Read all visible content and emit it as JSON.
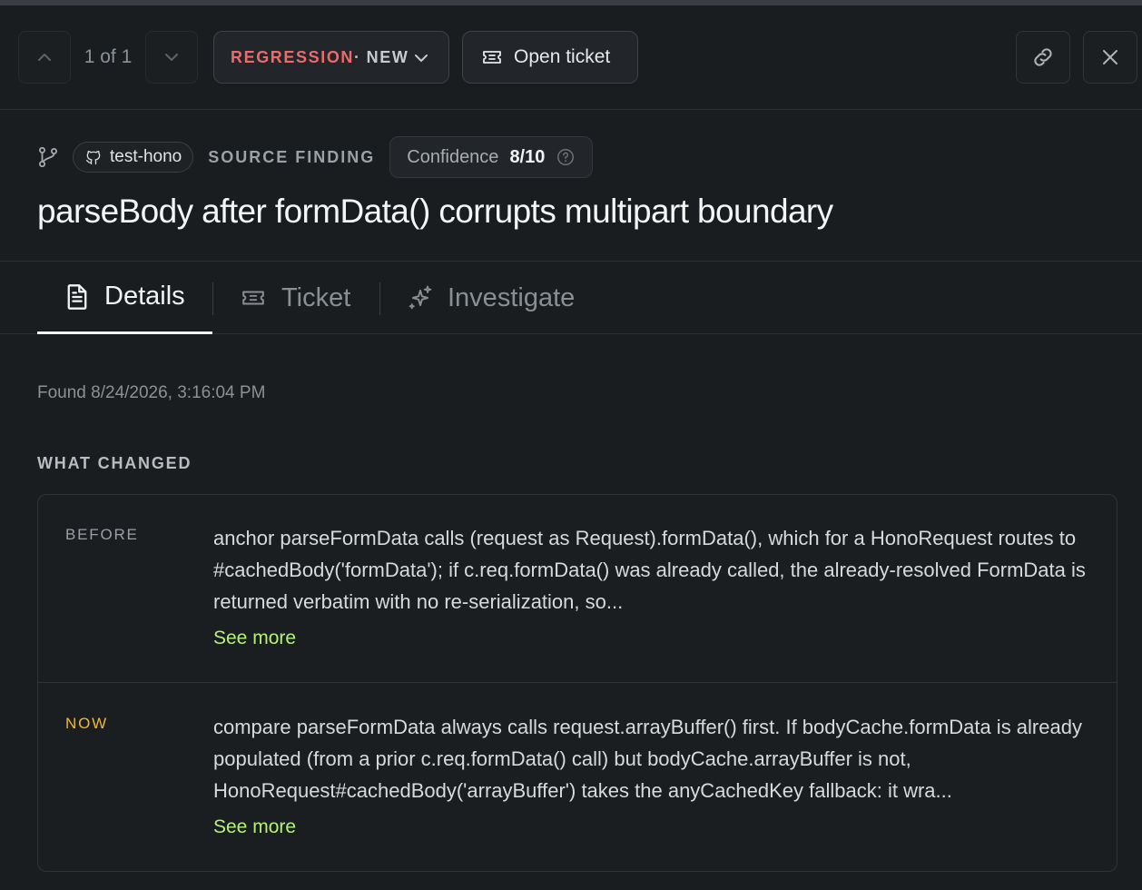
{
  "toolbar": {
    "counter": "1 of 1",
    "status": {
      "category": "REGRESSION",
      "separator": "·",
      "state": "NEW"
    },
    "open_ticket_label": "Open ticket"
  },
  "finding": {
    "repo": "test-hono",
    "source_label": "SOURCE FINDING",
    "confidence_label": "Confidence",
    "confidence_value": "8/10",
    "title": "parseBody after formData() corrupts multipart boundary"
  },
  "tabs": [
    {
      "label": "Details",
      "icon": "document-icon",
      "active": true
    },
    {
      "label": "Ticket",
      "icon": "ticket-icon",
      "active": false
    },
    {
      "label": "Investigate",
      "icon": "sparkles-icon",
      "active": false
    }
  ],
  "details": {
    "found": "Found 8/24/2026, 3:16:04 PM",
    "section_title": "WHAT CHANGED",
    "before": {
      "label": "BEFORE",
      "text": "anchor parseFormData calls (request as Request).formData(), which for a HonoRequest routes to #cachedBody('formData'); if c.req.formData() was already called, the already-resolved FormData is returned verbatim with no re-serialization, so...",
      "see_more": "See more"
    },
    "now": {
      "label": "NOW",
      "text": "compare parseFormData always calls request.arrayBuffer() first. If bodyCache.formData is already populated (from a prior c.req.formData() call) but bodyCache.arrayBuffer is not, HonoRequest#cachedBody('arrayBuffer') takes the anyCachedKey fallback: it wra...",
      "see_more": "See more"
    }
  },
  "colors": {
    "background": "#1a1d1f",
    "regression": "#e96b6b",
    "now_label": "#f0b73a",
    "link": "#b6f07a"
  }
}
